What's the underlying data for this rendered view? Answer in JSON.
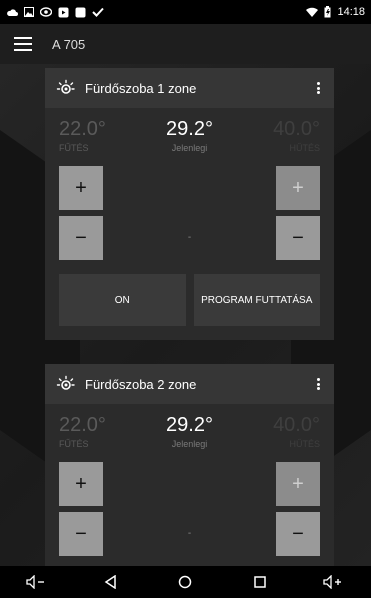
{
  "status": {
    "time": "14:18"
  },
  "app": {
    "title": "A 705"
  },
  "zones": [
    {
      "name": "Fürdőszoba 1 zone",
      "heat_value": "22.0°",
      "heat_label": "FŰTÉS",
      "current_value": "29.2°",
      "current_label": "Jelenlegi",
      "cool_value": "40.0°",
      "cool_label": "HŰTÉS",
      "plus": "+",
      "minus": "−",
      "mode_dash": "-",
      "on_label": "ON",
      "program_label": "PROGRAM FUTTATÁSA"
    },
    {
      "name": "Fürdőszoba 2 zone",
      "heat_value": "22.0°",
      "heat_label": "FŰTÉS",
      "current_value": "29.2°",
      "current_label": "Jelenlegi",
      "cool_value": "40.0°",
      "cool_label": "HŰTÉS",
      "plus": "+",
      "minus": "−",
      "mode_dash": "-"
    }
  ],
  "nav": {
    "vol_down": "◁−",
    "back": "◁",
    "home": "○",
    "recents": "□",
    "vol_up": "◁+"
  }
}
